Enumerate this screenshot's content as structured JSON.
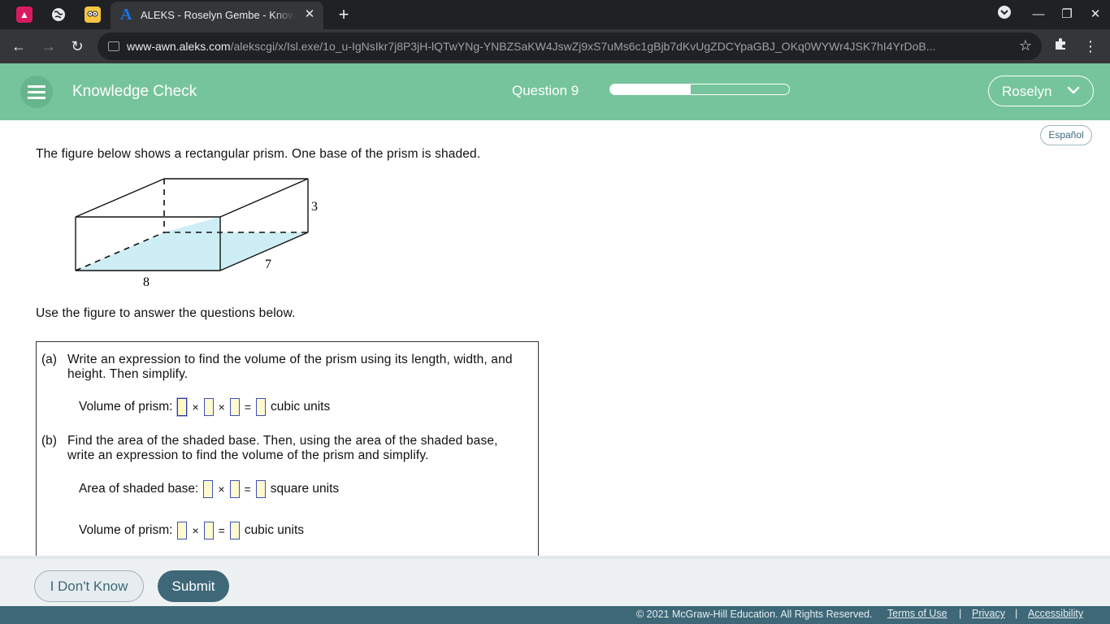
{
  "browser": {
    "tab_title": "ALEKS - Roselyn Gembe - Knowledge Check",
    "tab_logo": "A",
    "url_host": "www-awn.aleks.com",
    "url_path": "/alekscgi/x/Isl.exe/1o_u-IgNsIkr7j8P3jH-lQTwYNg-YNBZSaKW4JswZj9xS7uMs6c1gBjb7dKvUgZDCYpaGBJ_OKq0WYWr4JSK7hI4YrDoB...",
    "icons": [
      "back-arrow-icon",
      "forward-arrow-icon",
      "reload-icon",
      "star-icon",
      "extension-icon",
      "kebab-menu-icon"
    ]
  },
  "header": {
    "title": "Knowledge Check",
    "question_label": "Question 9",
    "progress_fraction": 0.45,
    "user_name": "Roselyn"
  },
  "content": {
    "language_button": "Español",
    "prompt": "The figure below shows a rectangular prism. One base of the prism is shaded.",
    "figure": {
      "length_label": "8",
      "width_label": "7",
      "height_label": "3",
      "shade_color": "#cdeef4"
    },
    "use_figure": "Use the figure to answer the questions below.",
    "part_a": {
      "label": "(a)",
      "text": "Write an expression to find the volume of the prism using its length, width, and height. Then simplify.",
      "row_label": "Volume of prism:",
      "unit": "cubic units"
    },
    "part_b": {
      "label": "(b)",
      "text": "Find the area of the shaded base. Then, using the area of the shaded base, write an expression to find the volume of the prism and simplify.",
      "area_label": "Area of shaded base:",
      "area_unit": "square units",
      "volume_label": "Volume of prism:",
      "volume_unit": "cubic units"
    },
    "ops": {
      "times": "×",
      "equals": "="
    }
  },
  "footer": {
    "idk_button": "I Don't Know",
    "submit_button": "Submit",
    "copyright": "© 2021 McGraw-Hill Education. All Rights Reserved.",
    "links": [
      "Terms of Use",
      "Privacy",
      "Accessibility"
    ],
    "separator": "|"
  }
}
